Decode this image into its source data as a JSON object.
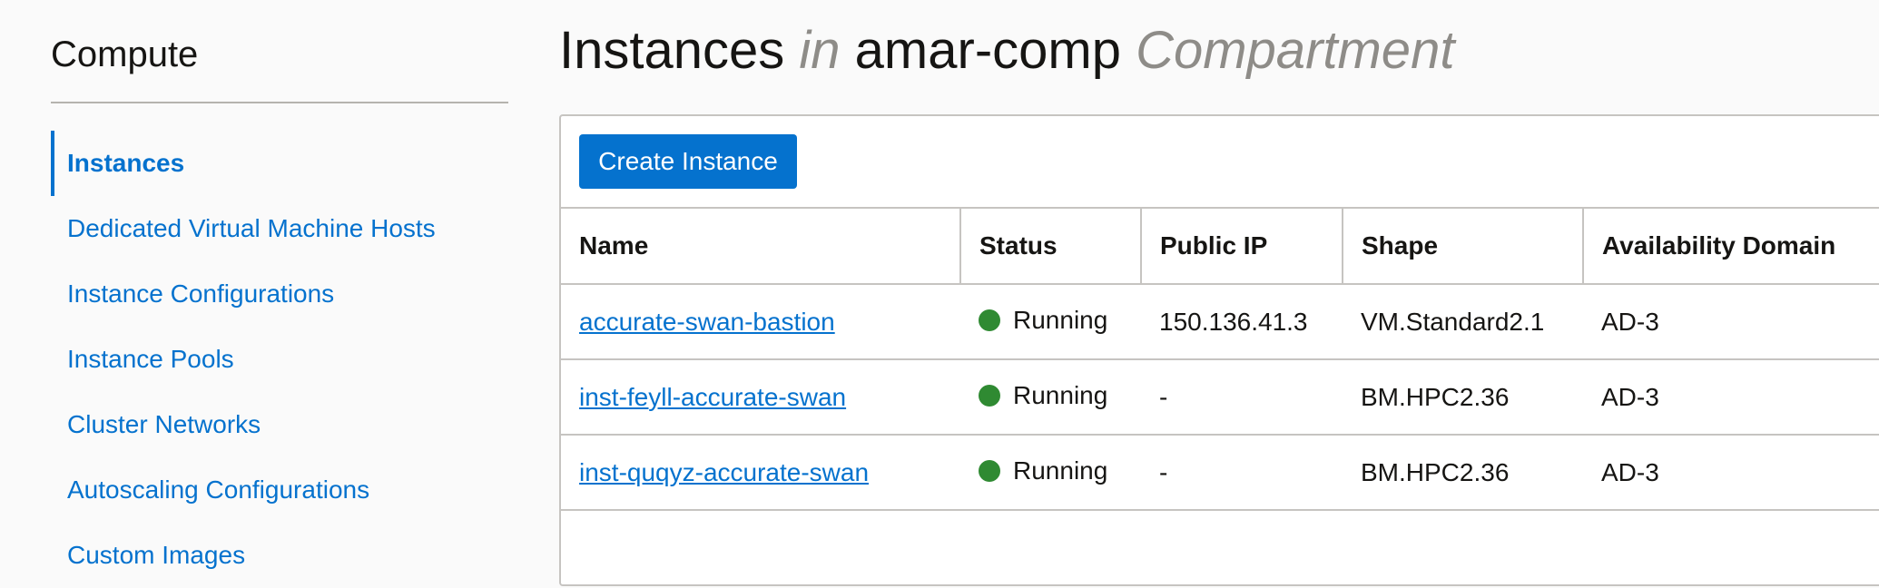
{
  "sidebar": {
    "title": "Compute",
    "items": [
      {
        "label": "Instances",
        "active": true
      },
      {
        "label": "Dedicated Virtual Machine Hosts",
        "active": false
      },
      {
        "label": "Instance Configurations",
        "active": false
      },
      {
        "label": "Instance Pools",
        "active": false
      },
      {
        "label": "Cluster Networks",
        "active": false
      },
      {
        "label": "Autoscaling Configurations",
        "active": false
      },
      {
        "label": "Custom Images",
        "active": false
      }
    ]
  },
  "header": {
    "title_main": "Instances",
    "title_in": "in",
    "compartment_name": "amar-comp",
    "title_suffix": "Compartment"
  },
  "toolbar": {
    "create_label": "Create Instance"
  },
  "table": {
    "columns": [
      "Name",
      "Status",
      "Public IP",
      "Shape",
      "Availability Domain"
    ],
    "rows": [
      {
        "name": "accurate-swan-bastion",
        "status": "Running",
        "public_ip": "150.136.41.3",
        "shape": "VM.Standard2.1",
        "ad": "AD-3"
      },
      {
        "name": "inst-feyll-accurate-swan",
        "status": "Running",
        "public_ip": "-",
        "shape": "BM.HPC2.36",
        "ad": "AD-3"
      },
      {
        "name": "inst-quqyz-accurate-swan",
        "status": "Running",
        "public_ip": "-",
        "shape": "BM.HPC2.36",
        "ad": "AD-3"
      }
    ]
  },
  "colors": {
    "accent": "#0572ce",
    "status_running": "#2f8a32",
    "muted_text": "#8e8c88",
    "border": "#c6c4c1"
  }
}
